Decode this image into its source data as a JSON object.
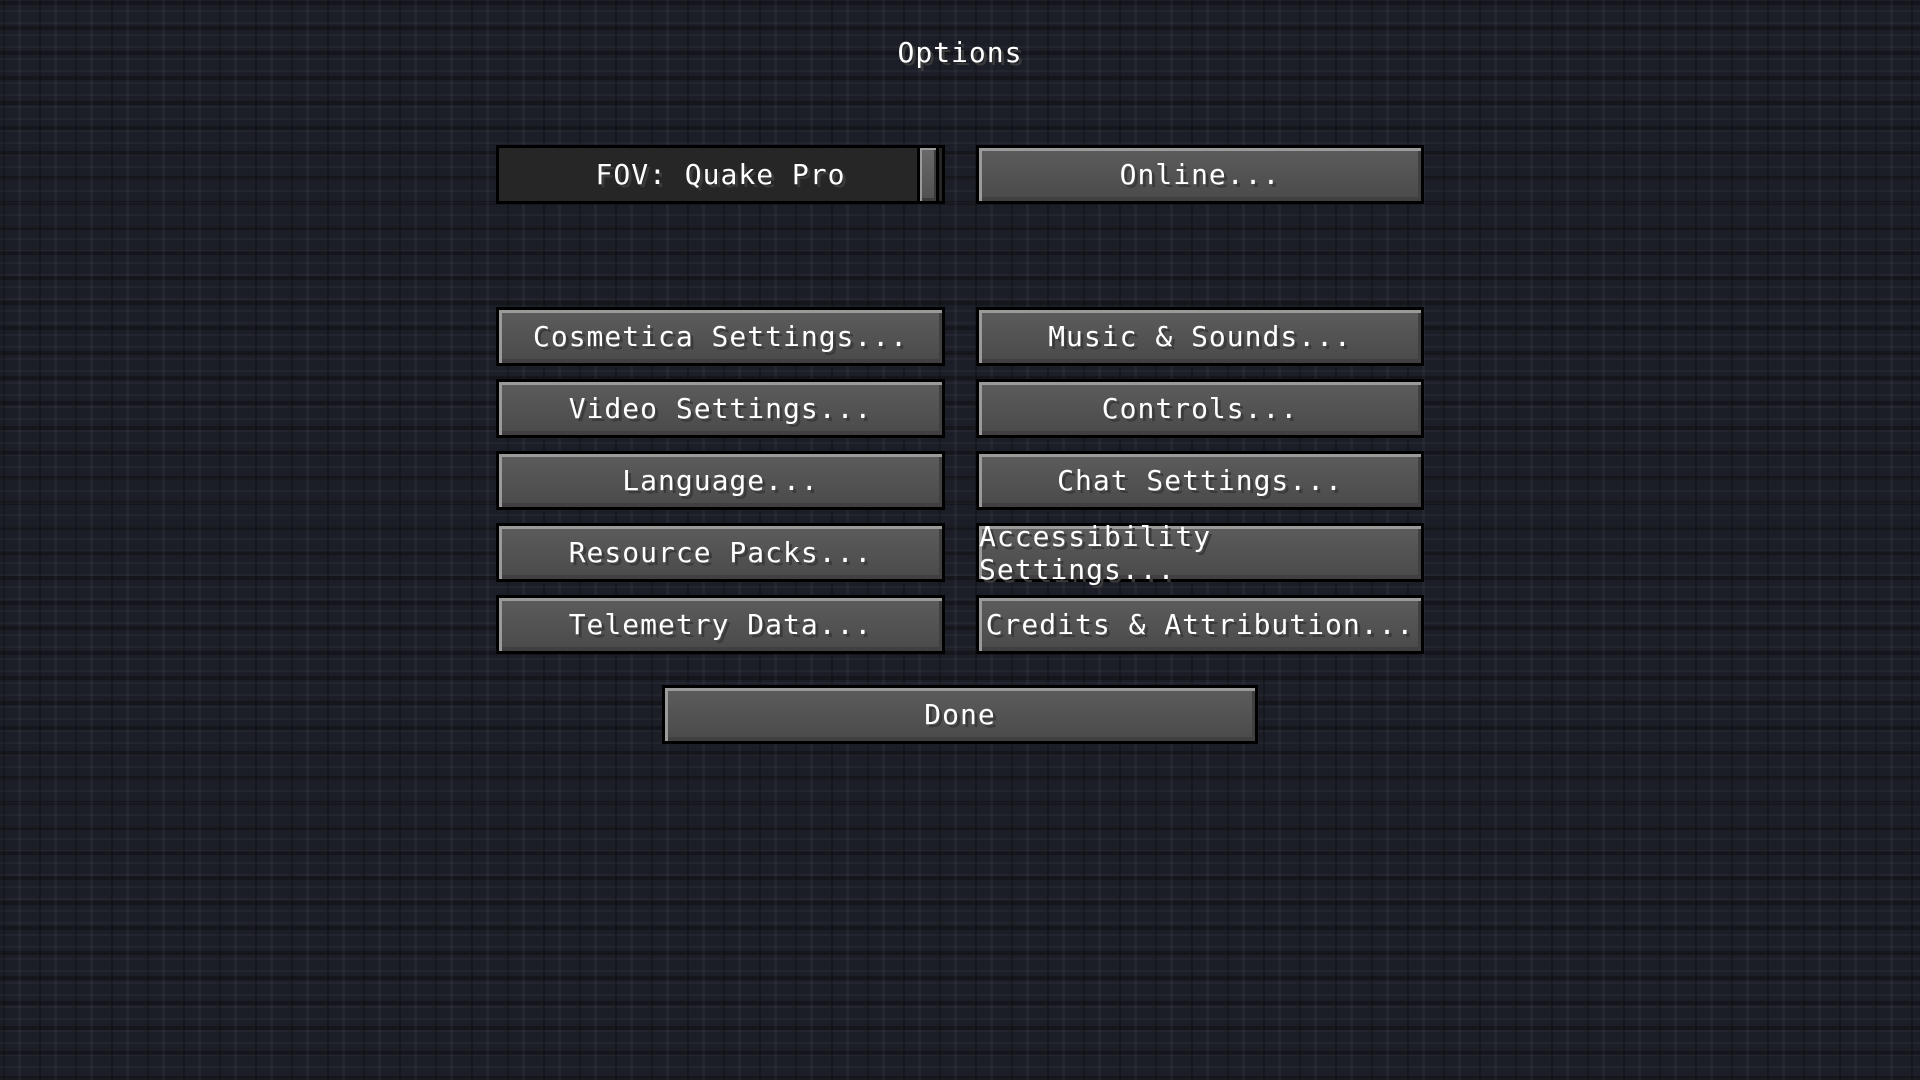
{
  "screen": {
    "title": "Options"
  },
  "fov_slider": {
    "label": "FOV: Quake Pro",
    "value_fraction": 1.0
  },
  "buttons": {
    "online": "Online...",
    "cosmetica_settings": "Cosmetica Settings...",
    "music_sounds": "Music & Sounds...",
    "video_settings": "Video Settings...",
    "controls": "Controls...",
    "language": "Language...",
    "chat_settings": "Chat Settings...",
    "resource_packs": "Resource Packs...",
    "accessibility_settings": "Accessibility Settings...",
    "telemetry_data": "Telemetry Data...",
    "credits_attribution": "Credits & Attribution...",
    "done": "Done"
  },
  "colors": {
    "text": "#ffffff",
    "button_face": "#555555",
    "background": "#1b1e27"
  }
}
